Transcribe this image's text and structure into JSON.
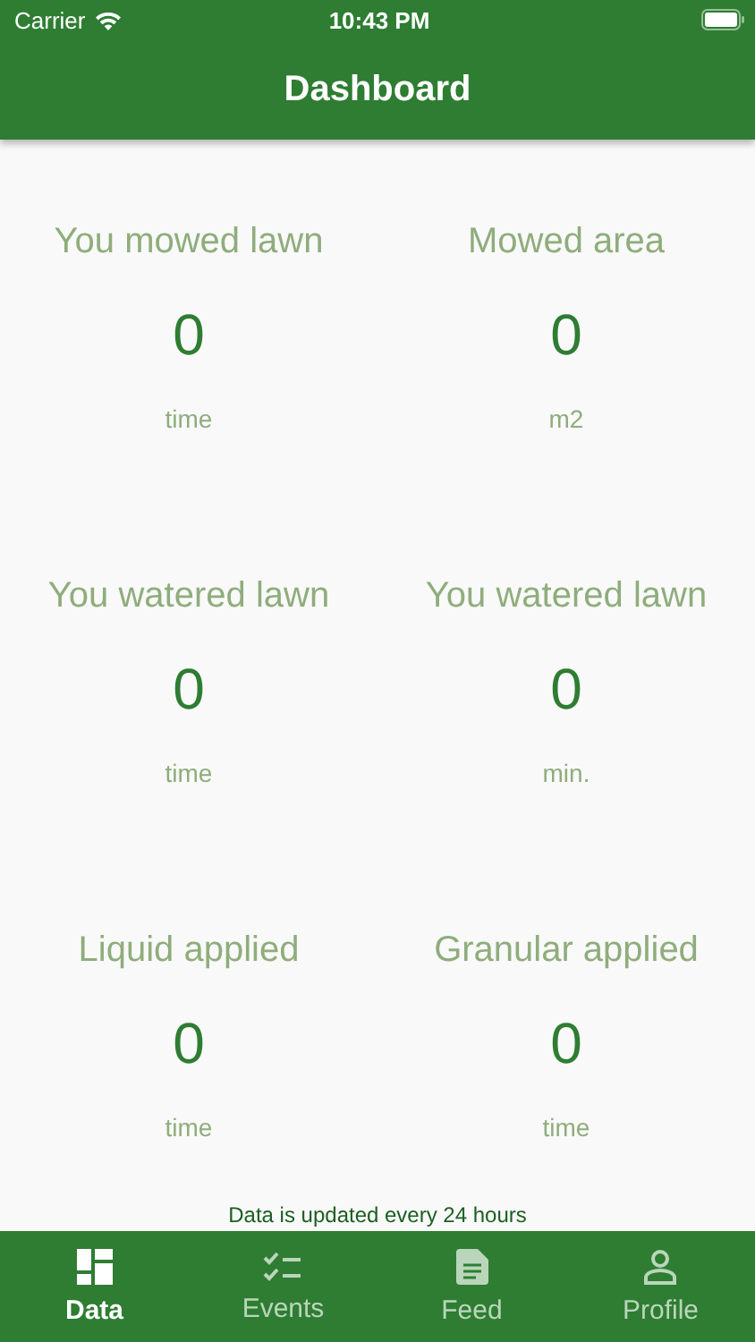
{
  "status_bar": {
    "carrier": "Carrier",
    "time": "10:43 PM"
  },
  "header": {
    "title": "Dashboard"
  },
  "stats": [
    {
      "title": "You mowed lawn",
      "value": "0",
      "unit": "time"
    },
    {
      "title": "Mowed area",
      "value": "0",
      "unit": "m2"
    },
    {
      "title": "You watered lawn",
      "value": "0",
      "unit": "time"
    },
    {
      "title": "You watered lawn",
      "value": "0",
      "unit": "min."
    },
    {
      "title": "Liquid applied",
      "value": "0",
      "unit": "time"
    },
    {
      "title": "Granular applied",
      "value": "0",
      "unit": "time"
    }
  ],
  "note": "Data is updated every 24 hours",
  "tabs": [
    {
      "label": "Data",
      "kind": "grid",
      "selected": true
    },
    {
      "label": "Events",
      "kind": "checklist",
      "selected": false
    },
    {
      "label": "Feed",
      "kind": "document",
      "selected": false
    },
    {
      "label": "Profile",
      "kind": "person",
      "selected": false
    }
  ]
}
